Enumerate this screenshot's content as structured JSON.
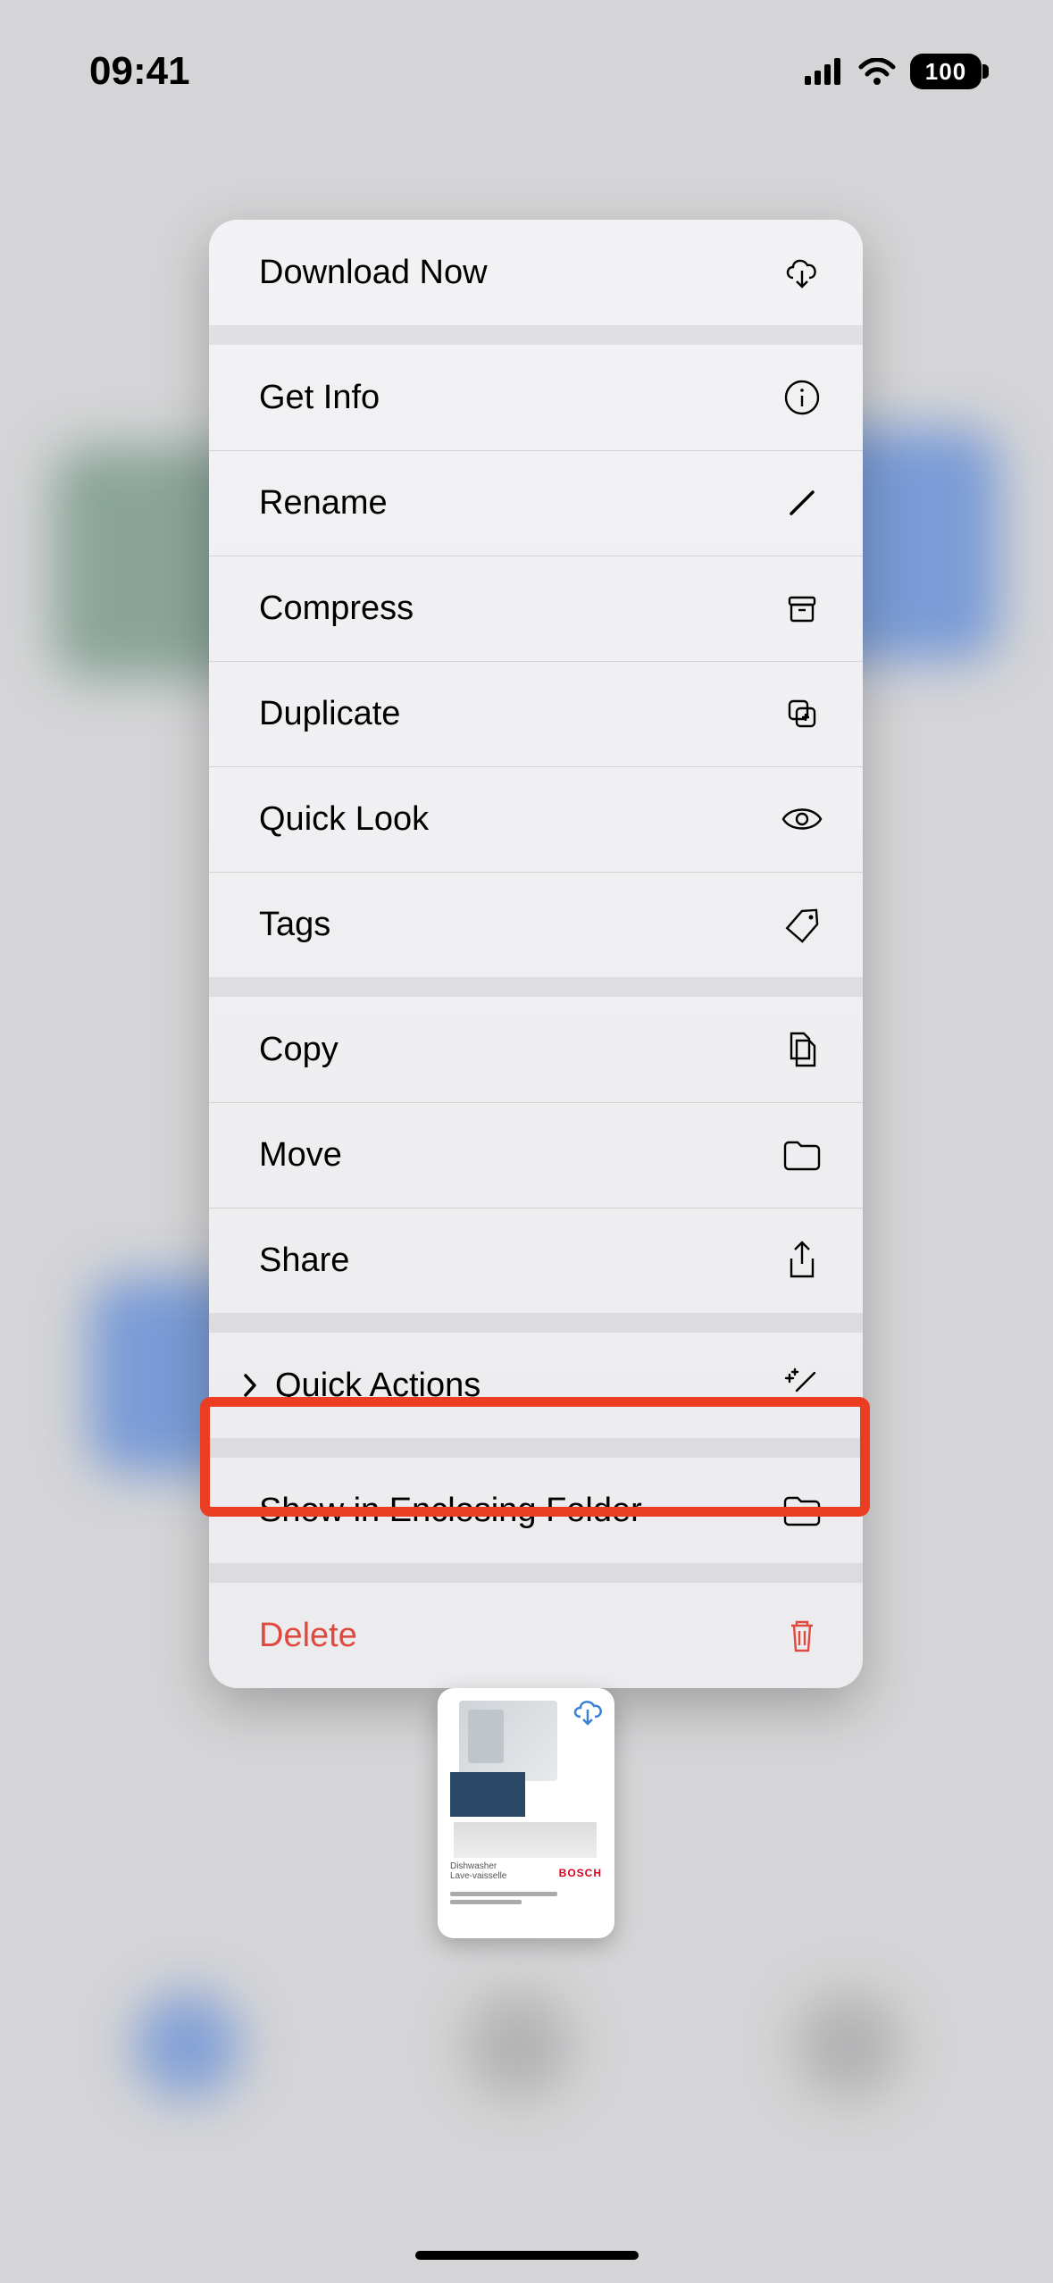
{
  "status": {
    "time": "09:41",
    "battery": "100"
  },
  "menu": {
    "download_now": "Download Now",
    "get_info": "Get Info",
    "rename": "Rename",
    "compress": "Compress",
    "duplicate": "Duplicate",
    "quick_look": "Quick Look",
    "tags": "Tags",
    "copy": "Copy",
    "move": "Move",
    "share": "Share",
    "quick_actions": "Quick Actions",
    "show_enclosing": "Show in Enclosing Folder",
    "delete": "Delete"
  },
  "thumbnail": {
    "title_line1": "Dishwasher",
    "title_line2": "Lave-vaisselle",
    "brand": "BOSCH"
  }
}
